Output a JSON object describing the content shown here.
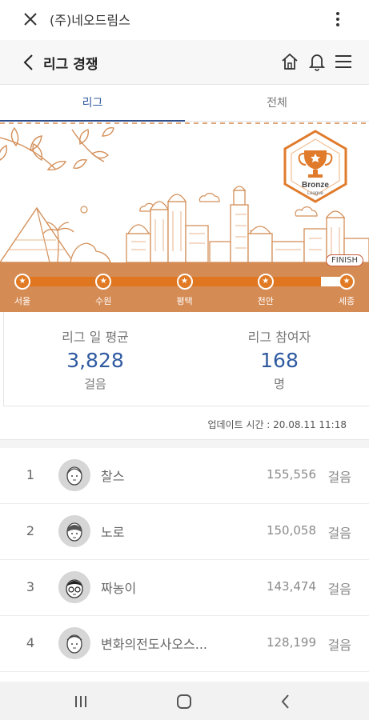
{
  "topbar": {
    "title": "(주)네오드림스"
  },
  "header": {
    "title": "리그 경쟁"
  },
  "tabs": [
    {
      "label": "리그",
      "active": true
    },
    {
      "label": "전체",
      "active": false
    }
  ],
  "league": {
    "badge_title": "Bronze",
    "badge_sub": "League",
    "finish_label": "FINISH",
    "progress_fraction": 0.92,
    "cities": [
      "서울",
      "수원",
      "평택",
      "천안",
      "세종"
    ]
  },
  "stats": {
    "avg": {
      "label": "리그 일 평균",
      "value": "3,828",
      "unit": "걸음"
    },
    "participants": {
      "label": "리그 참여자",
      "value": "168",
      "unit": "명"
    }
  },
  "updated": "업데이트 시간 : 20.08.11  11:18",
  "ranking": [
    {
      "rank": "1",
      "name": "찰스",
      "steps": "155,556",
      "unit": "걸음"
    },
    {
      "rank": "2",
      "name": "노로",
      "steps": "150,058",
      "unit": "걸음"
    },
    {
      "rank": "3",
      "name": "짜농이",
      "steps": "143,474",
      "unit": "걸음"
    },
    {
      "rank": "4",
      "name": "변화의전도사오스...",
      "steps": "128,199",
      "unit": "걸음"
    }
  ],
  "colors": {
    "accent": "#2f5aa0",
    "orange": "#e0761f",
    "bar": "#d58b54"
  },
  "icons": [
    "close-icon",
    "more-vert-icon",
    "back-icon",
    "home-icon",
    "bell-icon",
    "menu-icon",
    "star-icon",
    "trophy-icon",
    "avatar-icon",
    "recent-apps-icon",
    "home-button-icon",
    "nav-back-icon"
  ]
}
